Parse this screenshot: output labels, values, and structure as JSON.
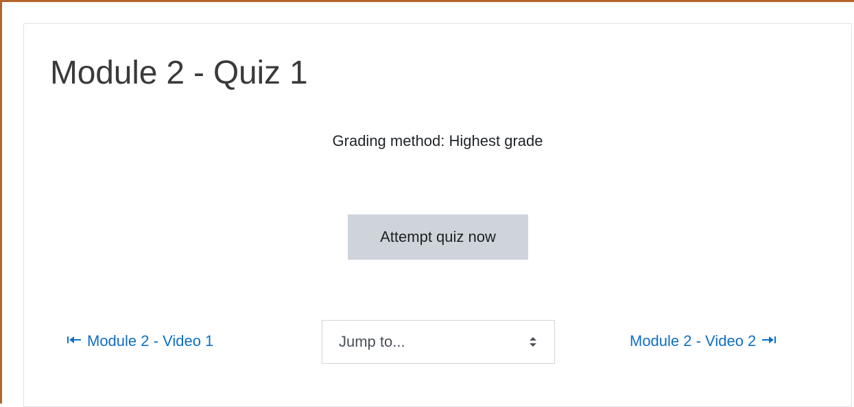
{
  "quiz": {
    "title": "Module 2 - Quiz 1",
    "grading_method": "Grading method: Highest grade",
    "attempt_label": "Attempt quiz now"
  },
  "navigation": {
    "prev": {
      "label": "Module 2 - Video 1",
      "arrow": "→"
    },
    "jump_to": {
      "selected": "Jump to..."
    },
    "next": {
      "label": "Module 2 - Video 2",
      "arrow": "→"
    }
  },
  "colors": {
    "link": "#0f6fc5",
    "button_bg": "#ced4da",
    "frame_border": "#b5642b",
    "card_border": "#dee2e6"
  },
  "icons": {
    "prev": "arrow-left-bar-icon",
    "next": "arrow-right-bar-icon",
    "select": "select-caret-icon"
  }
}
